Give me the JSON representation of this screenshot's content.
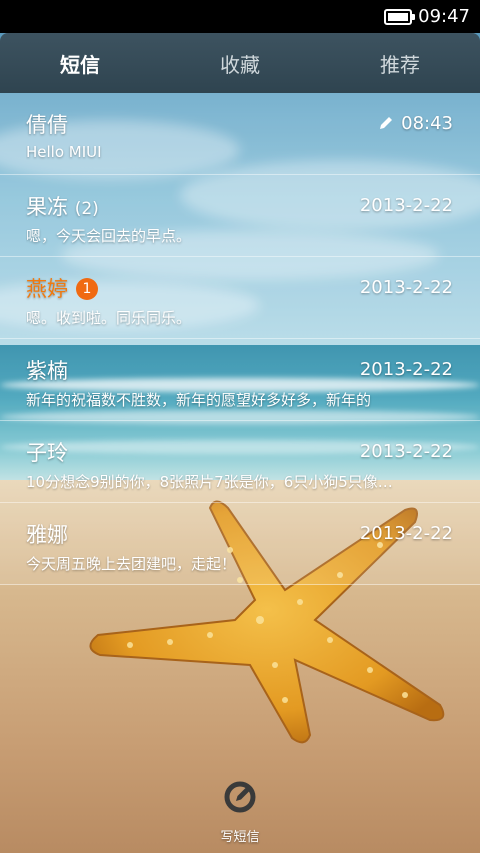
{
  "status": {
    "time": "09:47",
    "battery_level": 1.0
  },
  "tabs": [
    {
      "label": "短信",
      "active": true
    },
    {
      "label": "收藏",
      "active": false
    },
    {
      "label": "推荐",
      "active": false
    }
  ],
  "threads": [
    {
      "name": "倩倩",
      "count": "",
      "unread_badge": "",
      "date": "08:43",
      "preview": "Hello MIUI",
      "draft_icon": "pencil-icon"
    },
    {
      "name": "果冻",
      "count": "(2)",
      "unread_badge": "",
      "date": "2013-2-22",
      "preview": "嗯，今天会回去的早点。"
    },
    {
      "name": "燕婷",
      "count": "",
      "unread_badge": "1",
      "date": "2013-2-22",
      "preview": "嗯。收到啦。同乐同乐。"
    },
    {
      "name": "紫楠",
      "count": "",
      "unread_badge": "",
      "date": "2013-2-22",
      "preview": "新年的祝福数不胜数，新年的愿望好多好多，新年的"
    },
    {
      "name": "子玲",
      "count": "",
      "unread_badge": "",
      "date": "2013-2-22",
      "preview": "10分想念9别的你，8张照片7张是你，6只小狗5只像…"
    },
    {
      "name": "雅娜",
      "count": "",
      "unread_badge": "",
      "date": "2013-2-22",
      "preview": "今天周五晚上去团建吧，走起！"
    }
  ],
  "compose": {
    "label": "写短信",
    "icon": "compose-icon"
  },
  "colors": {
    "unread_name": "#f07a10",
    "badge": "#f06a12",
    "tabbar": "#34495a"
  }
}
